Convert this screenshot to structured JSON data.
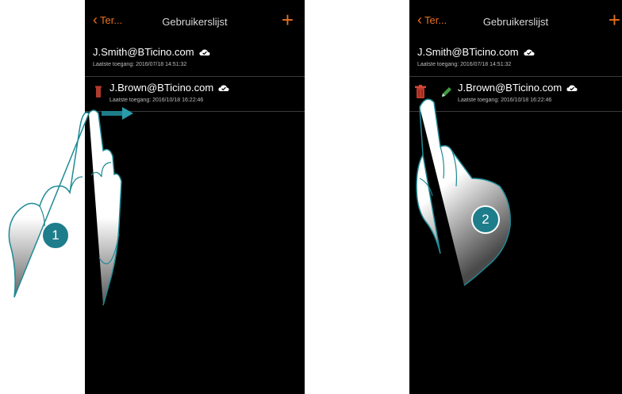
{
  "screens": [
    {
      "nav": {
        "back_label": "Ter...",
        "title": "Gebruikerslijst",
        "add_icon": "plus-icon"
      },
      "users": [
        {
          "email": "J.Smith@BTicino.com",
          "last_access": "Laatste toegang: 2016/07/18  14:51:32"
        },
        {
          "email": "J.Brown@BTicino.com",
          "last_access": "Laatste toegang: 2016/10/18  16:22:46"
        }
      ],
      "step": "1"
    },
    {
      "nav": {
        "back_label": "Ter...",
        "title": "Gebruikerslijst",
        "add_icon": "plus-icon"
      },
      "users": [
        {
          "email": "J.Smith@BTicino.com",
          "last_access": "Laatste toegang: 2016/07/18  14:51:32"
        },
        {
          "email": "J.Brown@BTicino.com",
          "last_access": "Laatste toegang: 2016/10/18  16:22:46"
        }
      ],
      "step": "2"
    }
  ],
  "colors": {
    "accent": "#e8711c",
    "badge": "#1e7d8a",
    "trash": "#c0392b",
    "pencil": "#3f9b3f",
    "hand_outline": "#1f8a96"
  }
}
